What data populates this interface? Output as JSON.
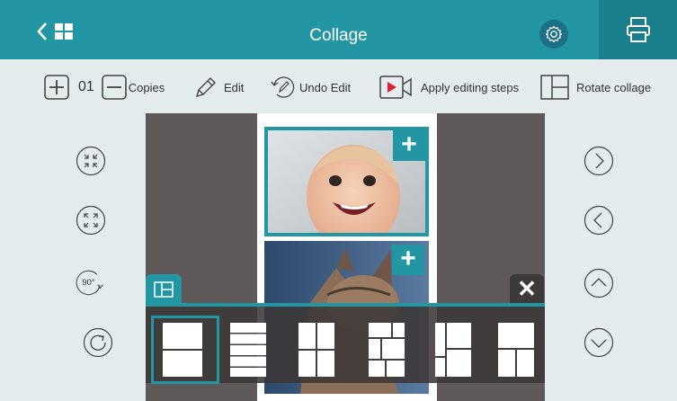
{
  "header": {
    "title": "Collage",
    "colors": {
      "bar": "#2296a3",
      "print_bg": "#1a7e8b",
      "gear_bg": "#1d6f86"
    }
  },
  "toolbar": {
    "copies_count": "01",
    "copies_label": "Copies",
    "edit_label": "Edit",
    "undo_label": "Undo Edit",
    "apply_label": "Apply editing steps",
    "rotate_label": "Rotate collage"
  },
  "left_controls": {
    "rotate_label": "90°"
  },
  "layouts": {
    "selected_index": 0,
    "count": 6
  }
}
